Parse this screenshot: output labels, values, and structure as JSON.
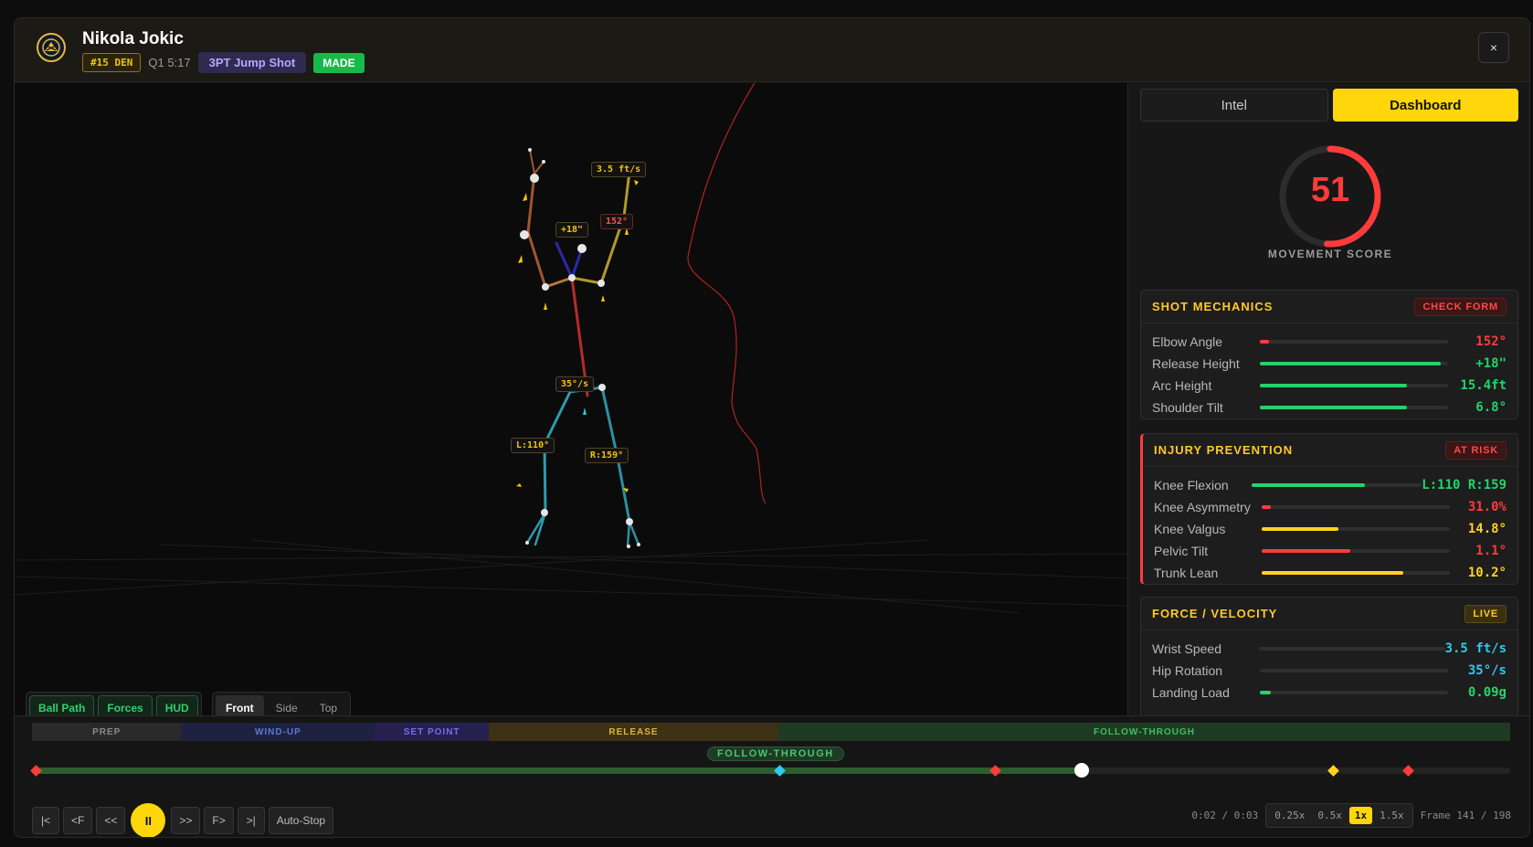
{
  "header": {
    "player_name": "Nikola Jokic",
    "team_chip": "#15 DEN",
    "clock": "Q1 5:17",
    "shot_type": "3PT Jump Shot",
    "result": "MADE",
    "close_label": "×"
  },
  "viewport": {
    "tags": {
      "wrist_speed": "3.5 ft/s",
      "elbow": "152°",
      "release": "+18\"",
      "hip_rotation": "35°/s",
      "left_knee": "L:110°",
      "right_knee": "R:159°"
    },
    "toggles": [
      "Ball Path",
      "Forces",
      "HUD"
    ],
    "views": [
      "Front",
      "Side",
      "Top"
    ],
    "active_view": "Front"
  },
  "panel": {
    "tabs": [
      "Intel",
      "Dashboard"
    ],
    "active_tab": "Dashboard",
    "score": {
      "value": "51",
      "label": "MOVEMENT SCORE",
      "fraction": 0.51
    },
    "shot_mechanics": {
      "title": "SHOT MECHANICS",
      "badge": "CHECK FORM",
      "rows": [
        {
          "label": "Elbow Angle",
          "value": "152°",
          "fill": 0.05,
          "color": "red"
        },
        {
          "label": "Release Height",
          "value": "+18\"",
          "fill": 0.96,
          "color": "green"
        },
        {
          "label": "Arc Height",
          "value": "15.4ft",
          "fill": 0.78,
          "color": "green"
        },
        {
          "label": "Shoulder Tilt",
          "value": "6.8°",
          "fill": 0.78,
          "color": "green"
        }
      ]
    },
    "injury_prevention": {
      "title": "INJURY PREVENTION",
      "badge": "AT RISK",
      "rows": [
        {
          "label": "Knee Flexion",
          "value": "L:110 R:159",
          "fill": 0.6,
          "color": "green"
        },
        {
          "label": "Knee Asymmetry",
          "value": "31.0%",
          "fill": 0.05,
          "color": "red"
        },
        {
          "label": "Knee Valgus",
          "value": "14.8°",
          "fill": 0.41,
          "color": "yellow"
        },
        {
          "label": "Pelvic Tilt",
          "value": "1.1°",
          "fill": 0.47,
          "color": "red"
        },
        {
          "label": "Trunk Lean",
          "value": "10.2°",
          "fill": 0.75,
          "color": "yellow"
        }
      ]
    },
    "force_velocity": {
      "title": "FORCE / VELOCITY",
      "badge": "LIVE",
      "rows": [
        {
          "label": "Wrist Speed",
          "value": "3.5 ft/s",
          "fill": 0.0,
          "color": "cyan"
        },
        {
          "label": "Hip Rotation",
          "value": "35°/s",
          "fill": 0.0,
          "color": "cyan"
        },
        {
          "label": "Landing Load",
          "value": "0.09g",
          "fill": 0.06,
          "color": "green"
        }
      ]
    }
  },
  "timeline": {
    "phases": [
      {
        "label": "PREP",
        "bg": "#2a2a2a",
        "fg": "#8a8a8a",
        "share": 0.101
      },
      {
        "label": "WIND-UP",
        "bg": "#1e2240",
        "fg": "#5a78d8",
        "share": 0.131
      },
      {
        "label": "SET POINT",
        "bg": "#252050",
        "fg": "#7a6ae6",
        "share": 0.077
      },
      {
        "label": "RELEASE",
        "bg": "#3d3215",
        "fg": "#e0b23a",
        "share": 0.196
      },
      {
        "label": "FOLLOW-THROUGH",
        "bg": "#1f3a22",
        "fg": "#3fbf5f",
        "share": 0.495
      }
    ],
    "current_phase": "FOLLOW-THROUGH",
    "progress": 0.71,
    "markers": [
      {
        "position": 0.0,
        "color": "#ff3b3b"
      },
      {
        "position": 0.506,
        "color": "#2fc8f0"
      },
      {
        "position": 0.653,
        "color": "#ff3b3b"
      },
      {
        "position": 0.883,
        "color": "#ffd21f"
      },
      {
        "position": 0.934,
        "color": "#ff3b3b"
      }
    ],
    "controls": [
      "|<",
      "<F",
      "<<",
      "II",
      ">>",
      "F>",
      ">|"
    ],
    "auto_stop": "Auto-Stop",
    "time": "0:02 / 0:03",
    "speeds": [
      "0.25x",
      "0.5x",
      "1x",
      "1.5x"
    ],
    "active_speed": "1x",
    "frame": "Frame 141 / 198"
  }
}
